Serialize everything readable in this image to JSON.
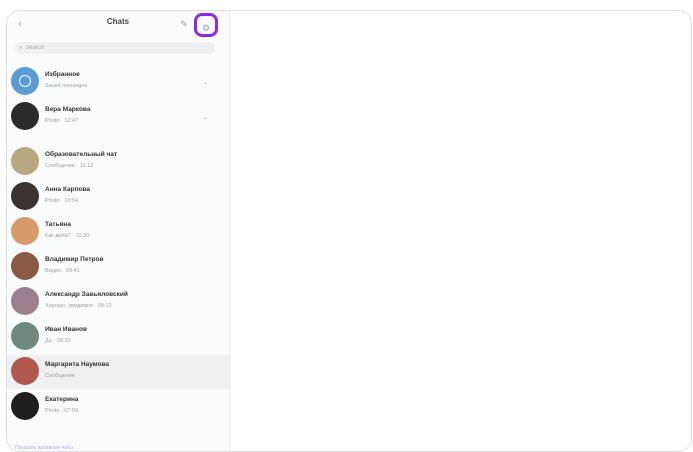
{
  "header": {
    "title": "Chats",
    "back_icon": "chevron-left-icon",
    "compose_icon": "compose-icon",
    "settings_icon": "settings-icon",
    "highlight_color": "#8a2be2"
  },
  "search": {
    "placeholder": "Search"
  },
  "chats": [
    {
      "name": "Избранное",
      "preview": "Saved messages",
      "color": "#5b9bd5",
      "pinned": true
    },
    {
      "name": "Вера Маркова",
      "preview": "Photo · 12:47",
      "color": "#2b2b2b",
      "pinned": true
    },
    {
      "name": "Образовательный чат",
      "preview": "Сообщение · 11:12",
      "color": "#b9a780",
      "pinned": false
    },
    {
      "name": "Анна Карпова",
      "preview": "Photo · 10:54",
      "color": "#3a3330",
      "pinned": false
    },
    {
      "name": "Татьяна",
      "preview": "Как дела? · 10:20",
      "color": "#d99a6a",
      "pinned": false
    },
    {
      "name": "Владимир Петров",
      "preview": "Видео · 09:41",
      "color": "#8a5a44",
      "pinned": false
    },
    {
      "name": "Александр Завьяловский",
      "preview": "Хорошо, увидимся · 09:12",
      "color": "#9b7f8e",
      "pinned": false
    },
    {
      "name": "Иван Иванов",
      "preview": "Да · 08:33",
      "color": "#6d8a7a",
      "pinned": false
    },
    {
      "name": "Маргарита Наумова",
      "preview": "Сообщение",
      "color": "#b0584d",
      "pinned": false,
      "active": true
    },
    {
      "name": "Екатерина",
      "preview": "Photo · 07:59",
      "color": "#1f1f1f",
      "pinned": false
    }
  ],
  "footer": {
    "link": "Показать архивные чаты"
  }
}
